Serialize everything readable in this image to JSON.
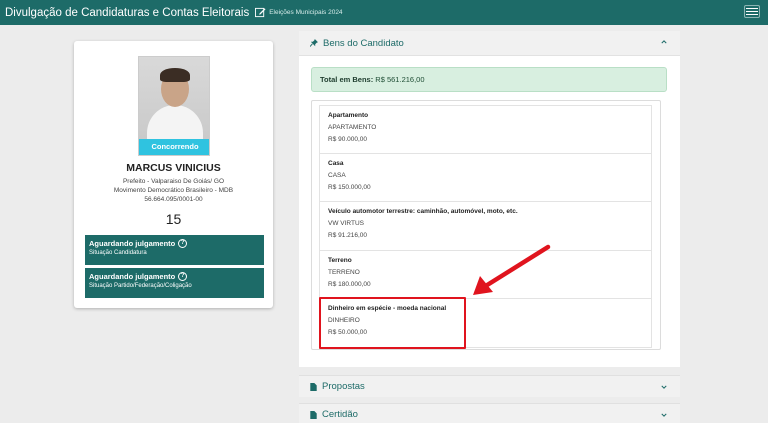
{
  "topbar": {
    "title": "Divulgação de Candidaturas e Contas Eleitorais",
    "subtitle": "Eleições Municipais 2024",
    "bg_color": "#1d6b68"
  },
  "candidate": {
    "status": "Concorrendo",
    "name": "MARCUS VINICIUS",
    "role": "Prefeito - Valparaiso De Goiás/ GO",
    "party": "Movimento Democrático Brasileiro - MDB",
    "cnpj": "56.664.095/0001-00",
    "number": "15",
    "judgements": [
      {
        "title": "Aguardando julgamento",
        "subtitle": "Situação Candidatura"
      },
      {
        "title": "Aguardando julgamento",
        "subtitle": "Situação Partido/Federação/Coligação"
      }
    ]
  },
  "bens": {
    "header": "Bens do Candidato",
    "total_label": "Total em Bens:",
    "total_value": "R$ 561.216,00",
    "items": [
      {
        "title": "Apartamento",
        "desc": "APARTAMENTO",
        "value": "R$ 90.000,00"
      },
      {
        "title": "Casa",
        "desc": "CASA",
        "value": "R$ 150.000,00"
      },
      {
        "title": "Veículo automotor terrestre: caminhão, automóvel, moto, etc.",
        "desc": "VW VIRTUS",
        "value": "R$ 91.216,00"
      },
      {
        "title": "Terreno",
        "desc": "TERRENO",
        "value": "R$ 180.000,00"
      },
      {
        "title": "Dinheiro em espécie - moeda nacional",
        "desc": "DINHEIRO",
        "value": "R$ 50.000,00"
      }
    ]
  },
  "sections": {
    "propostas": "Propostas",
    "certidao": "Certidão"
  },
  "colors": {
    "accent": "#1d6b68",
    "status": "#2fc3e0",
    "annotation": "#e0141e"
  }
}
